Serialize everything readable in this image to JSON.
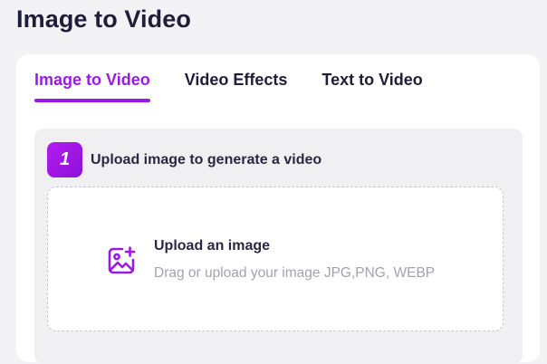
{
  "page": {
    "title": "Image to Video"
  },
  "tabs": [
    {
      "label": "Image to Video",
      "active": true
    },
    {
      "label": "Video Effects",
      "active": false
    },
    {
      "label": "Text to Video",
      "active": false
    }
  ],
  "step": {
    "number": "1",
    "label": "Upload image to generate a video"
  },
  "upload": {
    "title": "Upload an image",
    "hint": "Drag or upload your image JPG,PNG, WEBP",
    "icon": "image-add-icon"
  },
  "colors": {
    "accent": "#9b19e6",
    "text": "#1f1d3a",
    "muted": "#a3a3ad",
    "background": "#f3f3f6"
  }
}
